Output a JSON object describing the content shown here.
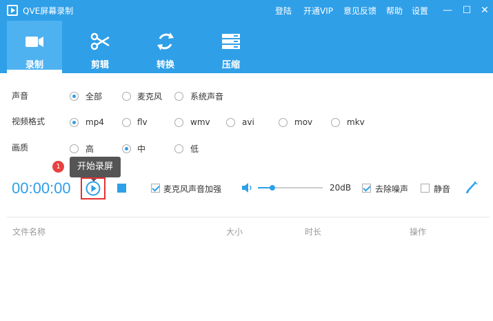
{
  "window": {
    "title": "QVE屏幕录制",
    "menu": [
      "登陆",
      "开通VIP",
      "意见反馈",
      "帮助",
      "设置"
    ],
    "controls": [
      "—",
      "☐",
      "✕"
    ]
  },
  "tabs": [
    {
      "label": "录制",
      "icon": "video-camera-icon",
      "active": true
    },
    {
      "label": "剪辑",
      "icon": "scissors-icon",
      "active": false
    },
    {
      "label": "转换",
      "icon": "convert-icon",
      "active": false
    },
    {
      "label": "压缩",
      "icon": "compress-icon",
      "active": false
    }
  ],
  "settings": {
    "sound": {
      "label": "声音",
      "options": [
        "全部",
        "麦克风",
        "系统声音"
      ],
      "selected": "全部"
    },
    "format": {
      "label": "视频格式",
      "options": [
        "mp4",
        "flv",
        "wmv",
        "avi",
        "mov",
        "mkv"
      ],
      "selected": "mp4"
    },
    "quality": {
      "label": "画质",
      "options": [
        "高",
        "中",
        "低"
      ],
      "selected": "中"
    }
  },
  "recorder": {
    "step_badge": "1",
    "tooltip": "开始录屏",
    "timer": "00:00:00",
    "mic_boost": {
      "label": "麦克风声音加强",
      "checked": true
    },
    "volume": {
      "value_label": "20dB",
      "level": 0.22
    },
    "denoise": {
      "label": "去除噪声",
      "checked": true
    },
    "mute": {
      "label": "静音",
      "checked": false
    }
  },
  "file_table": {
    "columns": [
      "文件名称",
      "大小",
      "时长",
      "操作"
    ]
  },
  "colors": {
    "accent": "#2f9fe8",
    "highlight": "#e53030"
  }
}
